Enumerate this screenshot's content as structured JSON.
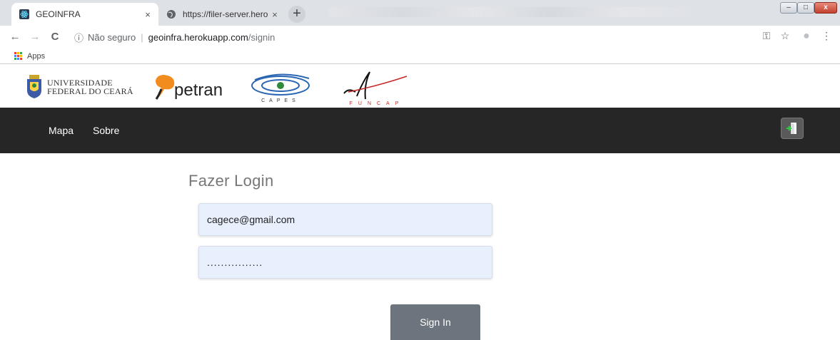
{
  "browser": {
    "tabs": [
      {
        "title": "GEOINFRA",
        "icon": "atom-icon",
        "close": "×"
      },
      {
        "title": "https://filer-server.herokuapp.co",
        "icon": "globe-icon",
        "close": "×"
      }
    ],
    "new_tab": "+",
    "window_controls": {
      "minimize": "–",
      "maximize": "□",
      "close": "x"
    },
    "nav": {
      "back": "←",
      "forward": "→",
      "reload": "C"
    },
    "address": {
      "info_icon": "ⓘ",
      "security": "Não seguro",
      "separator": "|",
      "host": "geoinfra.herokuapp.com",
      "path": "/signin"
    },
    "toolbar_icons": {
      "key": "⚿",
      "star": "☆",
      "profile": "●",
      "menu": "⋮"
    },
    "bookmarks": {
      "apps_label": "Apps"
    }
  },
  "header": {
    "ufc": {
      "line1": "UNIVERSIDADE",
      "line2": "FEDERAL DO CEARÁ"
    },
    "petran": "petran",
    "capes": "CAPES",
    "funcap": "FUNCAP"
  },
  "nav": {
    "links": [
      {
        "label": "Mapa"
      },
      {
        "label": "Sobre"
      }
    ]
  },
  "login": {
    "title": "Fazer Login",
    "email_value": "cagece@gmail.com",
    "password_value": "................",
    "submit_label": "Sign In"
  },
  "colors": {
    "navbar_bg": "#262626",
    "field_bg": "#e8f0fe",
    "button_bg": "#6c757d",
    "title_color": "#777777"
  }
}
